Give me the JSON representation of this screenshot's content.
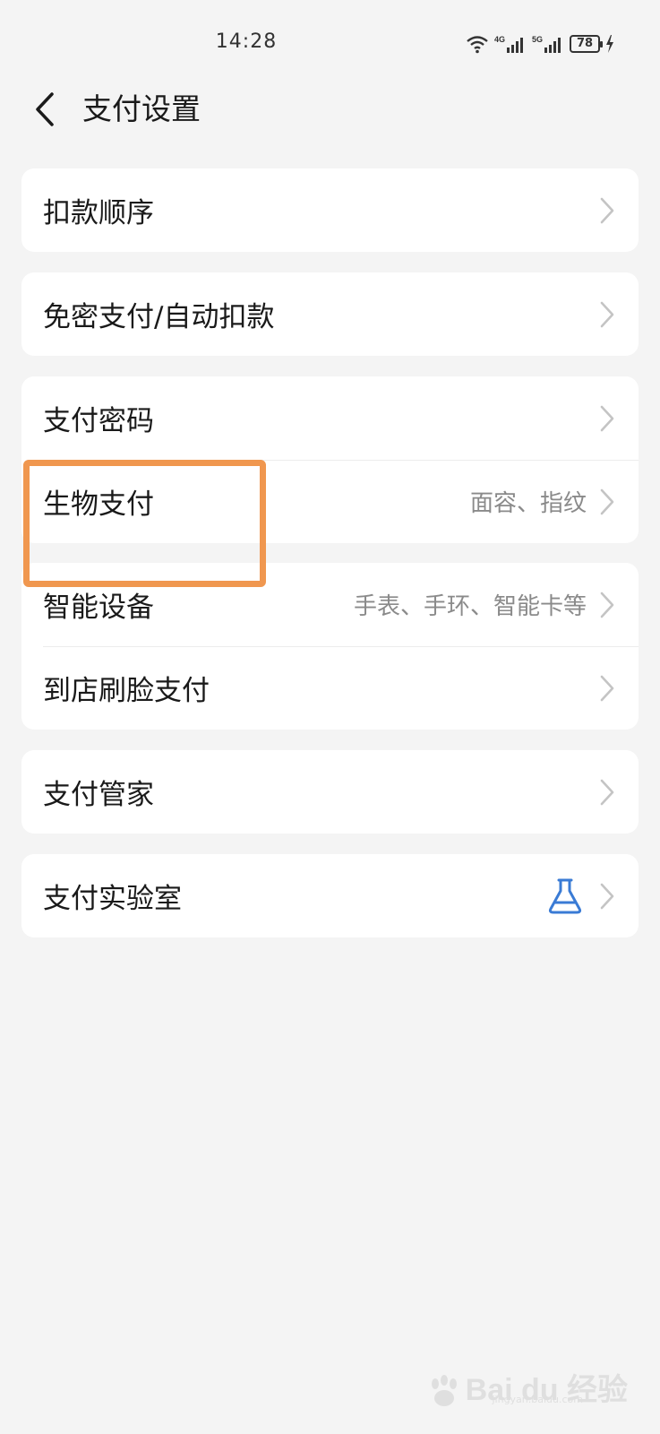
{
  "status_bar": {
    "time": "14:28",
    "network_1": "4G",
    "network_2": "5G",
    "battery": "78"
  },
  "header": {
    "back_icon": "chevron-left-icon",
    "title": "支付设置"
  },
  "cards": [
    {
      "rows": [
        {
          "label": "扣款顺序",
          "value": ""
        }
      ]
    },
    {
      "rows": [
        {
          "label": "免密支付/自动扣款",
          "value": ""
        }
      ]
    },
    {
      "rows": [
        {
          "label": "支付密码",
          "value": ""
        },
        {
          "label": "生物支付",
          "value": "面容、指纹"
        }
      ]
    },
    {
      "rows": [
        {
          "label": "智能设备",
          "value": "手表、手环、智能卡等"
        },
        {
          "label": "到店刷脸支付",
          "value": ""
        }
      ]
    },
    {
      "rows": [
        {
          "label": "支付管家",
          "value": ""
        }
      ]
    },
    {
      "rows": [
        {
          "label": "支付实验室",
          "value": "",
          "icon": "flask-icon"
        }
      ]
    }
  ],
  "annotation": {
    "highlight_color": "#f0974f",
    "highlights": "生物支付"
  },
  "watermark": {
    "brand": "Bai du 经验",
    "url": "jingyan.baidu.com"
  },
  "colors": {
    "background": "#f4f4f4",
    "card": "#ffffff",
    "accent": "#3a7bd5"
  }
}
